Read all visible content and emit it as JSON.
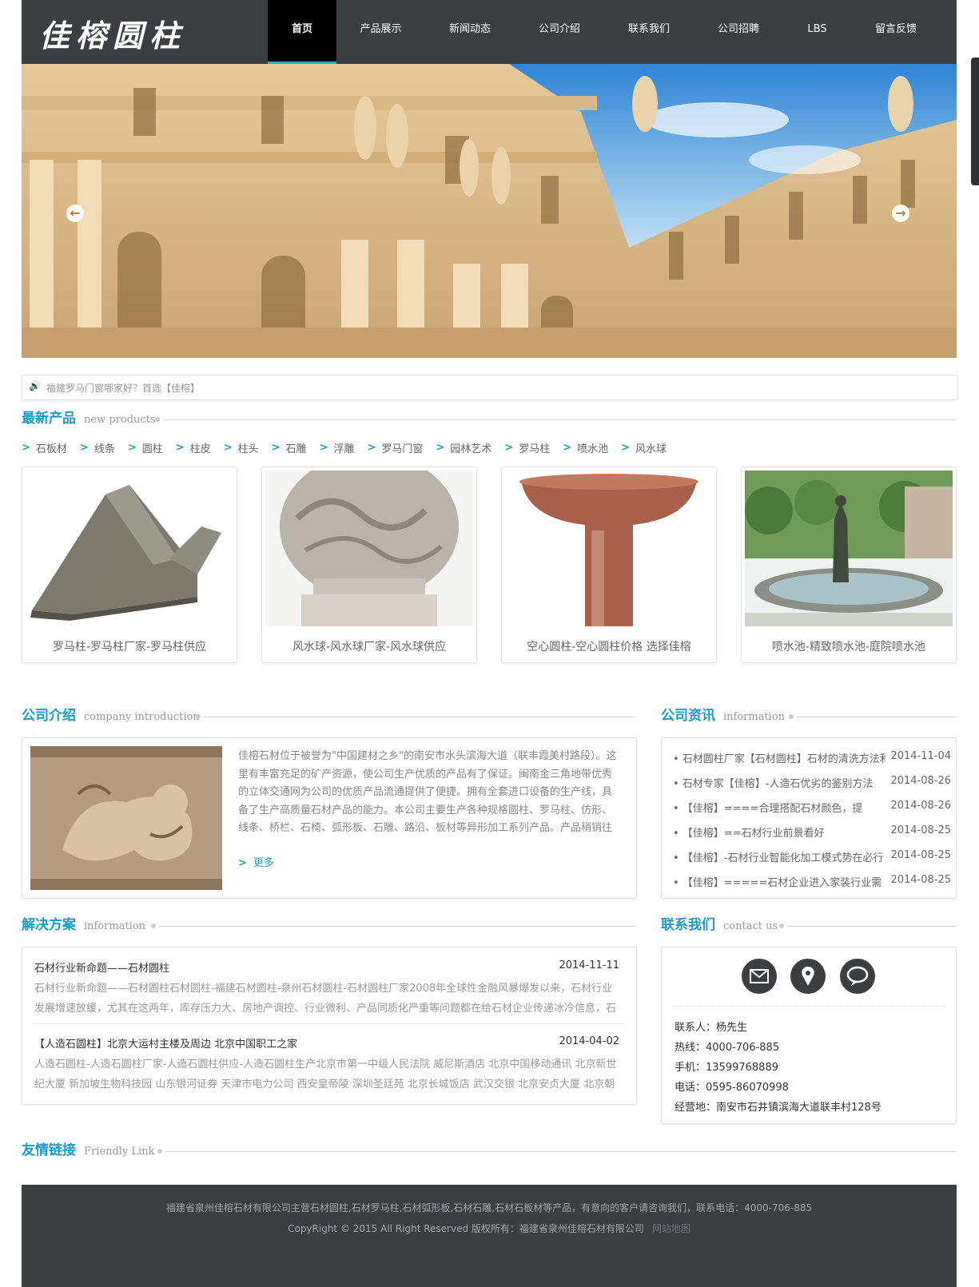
{
  "logo": {
    "text": "佳榕圆柱"
  },
  "nav": {
    "items": [
      {
        "label": "首页",
        "active": true
      },
      {
        "label": "产品展示"
      },
      {
        "label": "新闻动态"
      },
      {
        "label": "公司介绍"
      },
      {
        "label": "联系我们"
      },
      {
        "label": "公司招聘"
      },
      {
        "label": "LBS"
      },
      {
        "label": "留言反馈"
      }
    ]
  },
  "notice": {
    "text": "福建罗马门窗哪家好？首选【佳榕】"
  },
  "products_section": {
    "title": "最新产品",
    "subtitle": "new products"
  },
  "categories": [
    "石板材",
    "线条",
    "圆柱",
    "柱皮",
    "柱头",
    "石雕",
    "浮雕",
    "罗马门窗",
    "园林艺术",
    "罗马柱",
    "喷水池",
    "风水球"
  ],
  "products": [
    {
      "caption": "罗马柱-罗马柱厂家-罗马柱供应"
    },
    {
      "caption": "风水球-风水球厂家-风水球供应"
    },
    {
      "caption": "空心圆柱-空心圆柱价格 选择佳榕"
    },
    {
      "caption": "喷水池-精致喷水池-庭院喷水池"
    }
  ],
  "intro_section": {
    "title": "公司介绍",
    "subtitle": "company introduction"
  },
  "intro": {
    "text": "佳榕石材位于被誉为\"中国建材之乡\"的南安市水头滨海大道（联丰霞美村路段）。这里有丰富充足的矿产资源，使公司生产优质的产品有了保证。闽南金三角地带优秀的立体交通网为公司的优质产品流通提供了便捷。拥有全套进口设备的生产线，具备了生产高质量石材产品的能力。本公司主要生产各种规格圆柱、罗马柱、仿形、线条、桥栏、石椅、弧形板、石雕、路沿、板材等异形加工系列产品。产品稍销往全国各地",
    "more": "更多"
  },
  "info_section": {
    "title": "公司资讯",
    "subtitle": "information"
  },
  "news": [
    {
      "title": "• 石材圆柱厂家【石材圆柱】石材的清洗方法和",
      "date": "2014-11-04"
    },
    {
      "title": "• 石材专家【佳榕】-人造石优劣的鉴别方法",
      "date": "2014-08-26"
    },
    {
      "title": "• 【佳榕】====合理搭配石材颜色，提",
      "date": "2014-08-26"
    },
    {
      "title": "• 【佳榕】==石材行业前景看好",
      "date": "2014-08-25"
    },
    {
      "title": "• 【佳榕】-石材行业智能化加工模式势在必行",
      "date": "2014-08-25"
    },
    {
      "title": "• 【佳榕】=====石材企业进入家装行业需",
      "date": "2014-08-25"
    }
  ],
  "solutions_section": {
    "title": "解决方案",
    "subtitle": "information"
  },
  "solutions": [
    {
      "title": "石材行业新命题——石材圆柱",
      "date": "2014-11-11",
      "desc": "石材行业新命题——石材圆柱石材圆柱-福建石材圆柱-泉州石材圆柱-石材圆柱厂家2008年全球性金融风暴爆发以来，石材行业发展增速放缓，尤其在这两年，库存压力大、房地产调控、行业微利、产品同质化严重等问题都在给石材企业传递冰冷信息，石材"
    },
    {
      "title": "【人造石圆柱】北京大运村主楼及周边 北京中国职工之家",
      "date": "2014-04-02",
      "desc": "人造石圆柱-人造石圆柱厂家-人造石圆柱供应-人造石圆柱生产北京市第一中级人民法院 威尼斯酒店 北京中国移动通讯 北京新世纪大厦 新加坡生物科技园 山东银河证券 天津市电力公司 西安皇帝陵 深圳圣廷苑 北京长城饭店 武汉交银 北京安贞大厦 北京朝"
    }
  ],
  "contact_section": {
    "title": "联系我们",
    "subtitle": "contact us"
  },
  "contact": {
    "person": "联系人：杨先生",
    "hotline": "热线：4000-706-885",
    "mobile": "手机：13599768889",
    "phone": "电话：0595-86070998",
    "address": "经营地：南安市石井镇滨海大道联丰村128号"
  },
  "links_section": {
    "title": "友情链接",
    "subtitle": "Friendly Link"
  },
  "footer": {
    "desc": "福建省泉州佳榕石材有限公司主营石材圆柱,石材罗马柱,石材弧形板,石材石雕,石材石板材等产品，有意向的客户请咨询我们，联系电话：4000-706-885",
    "copyright": "CopyRight © 2015 All Right Reserved 版权所有：福建省泉州佳榕石材有限公司",
    "sitemap": "网站地图"
  },
  "colors": {
    "header_bg": "#3b3f42",
    "accent": "#1a9cc9",
    "footer_bg": "#3b3f42"
  }
}
